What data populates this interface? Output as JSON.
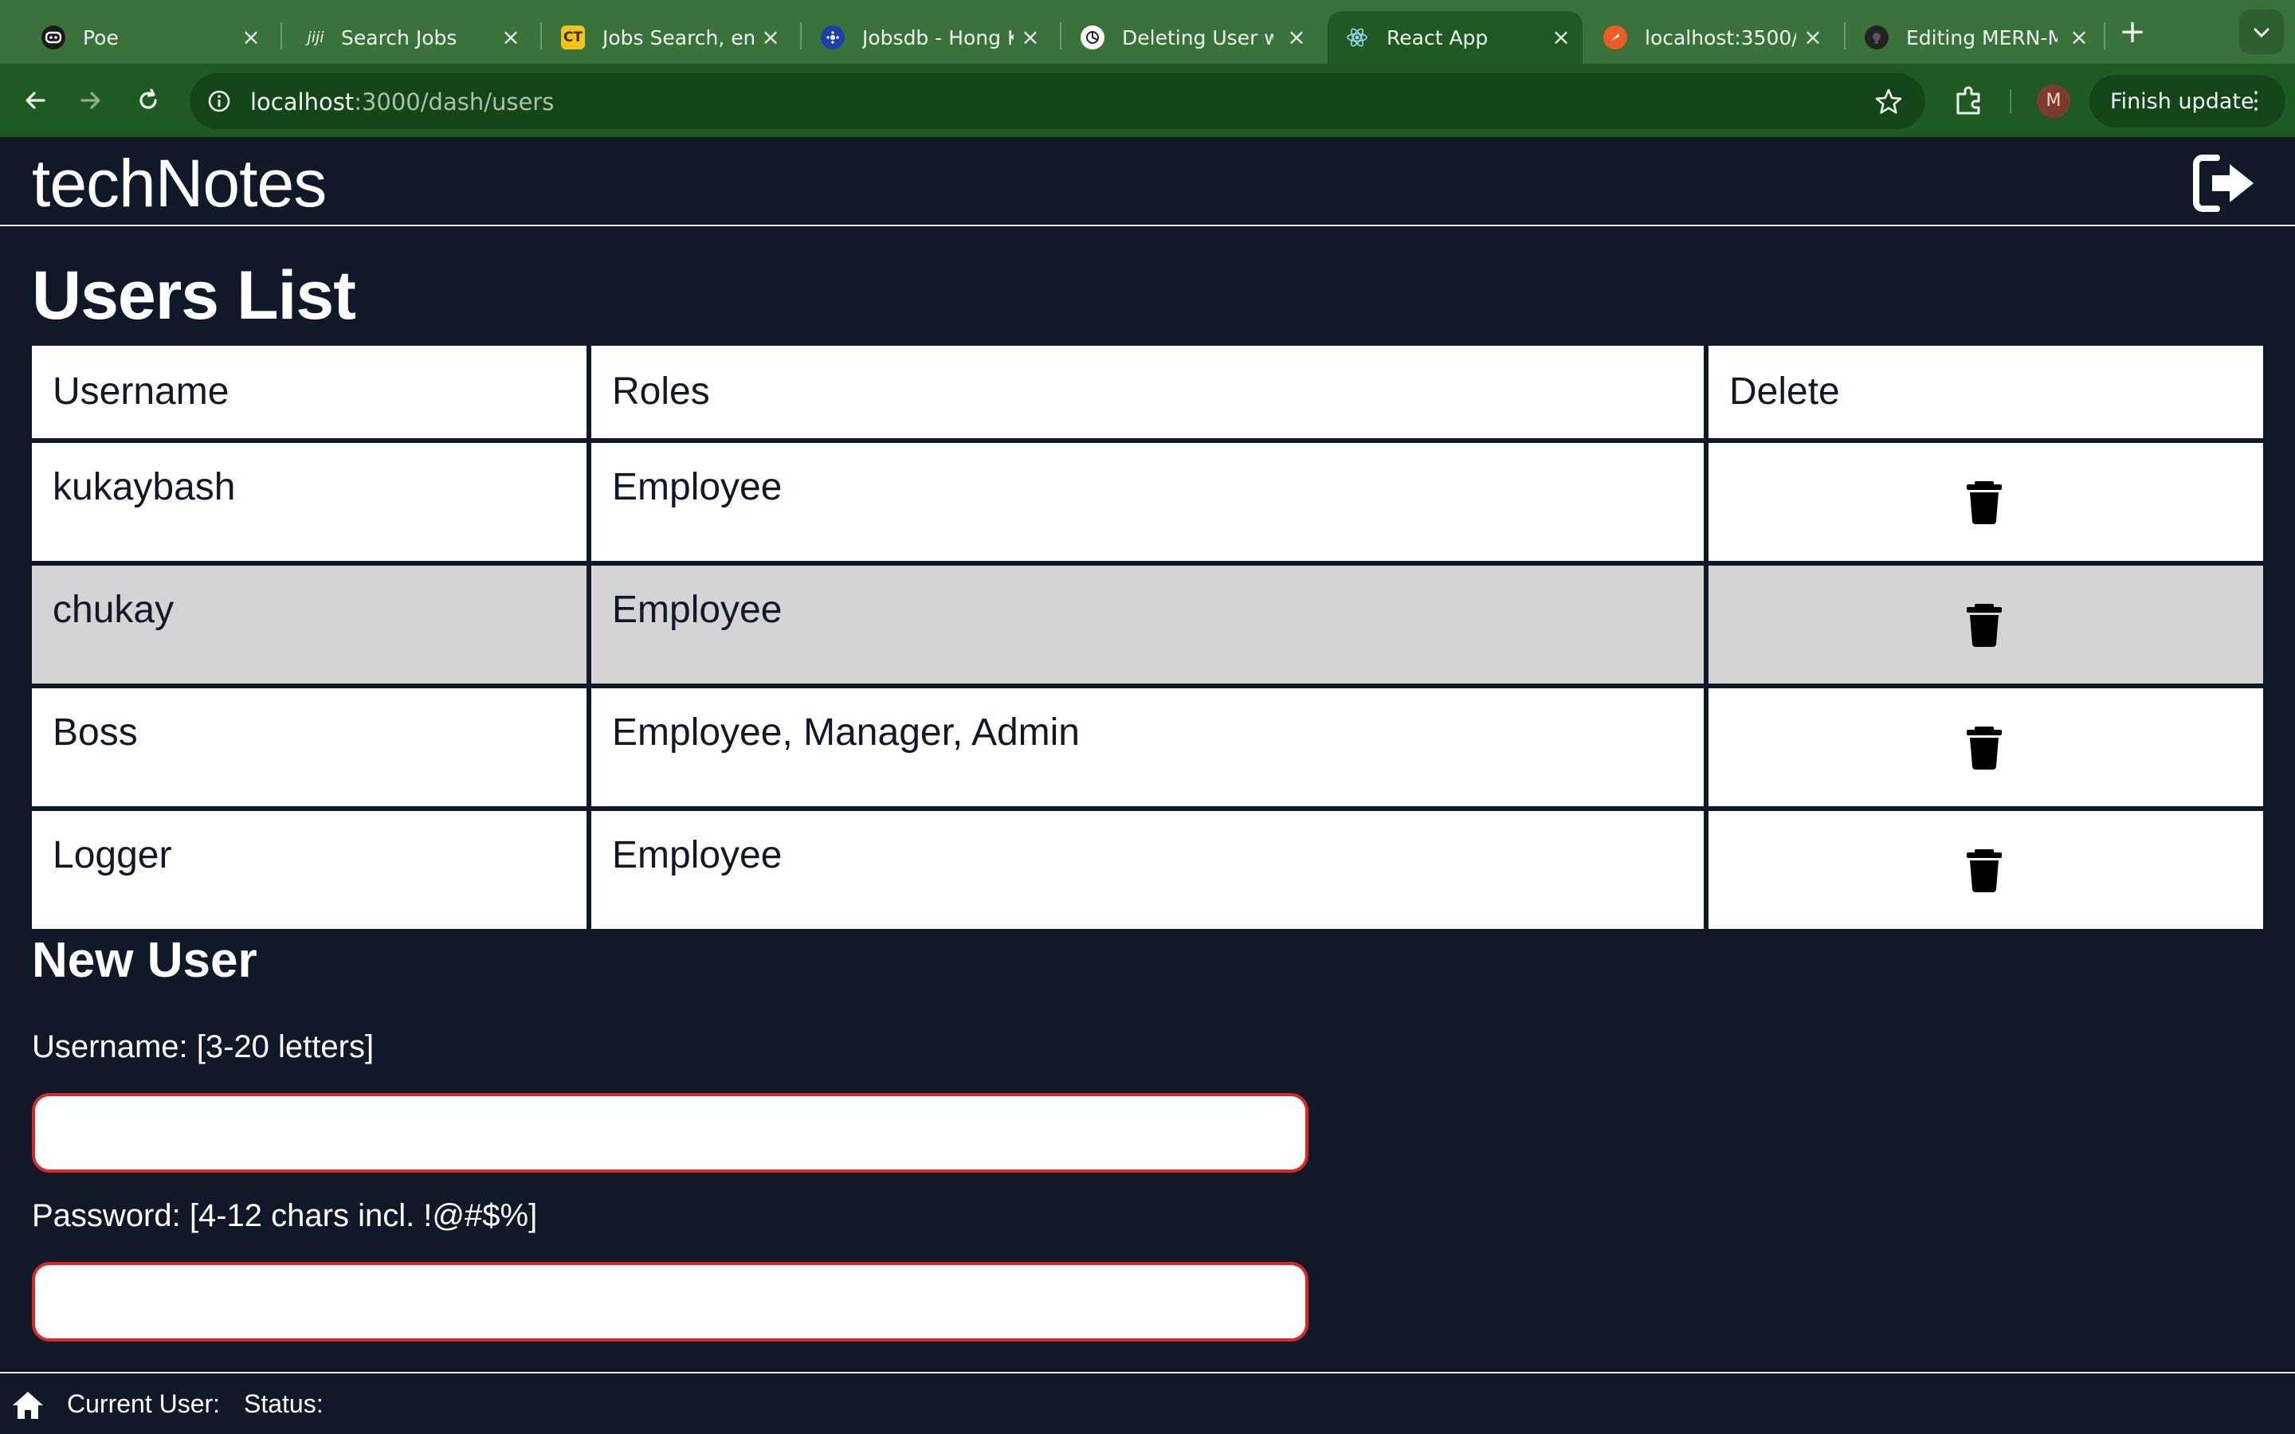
{
  "browser": {
    "tabs": [
      {
        "title": "Poe",
        "favicon": "poe-icon",
        "favicon_color": "#1a1a1a",
        "active": false
      },
      {
        "title": "Search Jobs",
        "favicon": "jiji-icon",
        "favicon_color": "#3d6e3f",
        "active": false
      },
      {
        "title": "Jobs Search, em",
        "favicon": "ct-icon",
        "favicon_color": "#f0c419",
        "active": false
      },
      {
        "title": "Jobsdb - Hong K",
        "favicon": "jobsdb-icon",
        "favicon_color": "#1d3fa8",
        "active": false
      },
      {
        "title": "Deleting User w",
        "favicon": "chatgpt-icon",
        "favicon_color": "#ffffff",
        "active": false
      },
      {
        "title": "React App",
        "favicon": "react-icon",
        "favicon_color": "#61dafb",
        "active": true
      },
      {
        "title": "localhost:3500/",
        "favicon": "postman-icon",
        "favicon_color": "#ef5b25",
        "active": false
      },
      {
        "title": "Editing MERN-M",
        "favicon": "github-icon",
        "favicon_color": "#222222",
        "active": false
      }
    ],
    "url_host": "localhost",
    "url_path": ":3000/dash/users",
    "avatar_letter": "M",
    "finish_update_label": "Finish update"
  },
  "app": {
    "title": "techNotes",
    "page_title": "Users List",
    "table": {
      "headers": [
        "Username",
        "Roles",
        "Delete"
      ],
      "rows": [
        {
          "username": "kukaybash",
          "roles": "Employee"
        },
        {
          "username": "chukay",
          "roles": "Employee"
        },
        {
          "username": "Boss",
          "roles": "Employee, Manager, Admin"
        },
        {
          "username": "Logger",
          "roles": "Employee"
        }
      ]
    },
    "form": {
      "title": "New User",
      "username_label": "Username: [3-20 letters]",
      "username_value": "",
      "password_label": "Password: [4-12 chars incl. !@#$%]",
      "password_value": ""
    },
    "footer": {
      "current_user_label": "Current User:",
      "status_label": "Status:"
    }
  },
  "colors": {
    "chrome_bg": "#39733b",
    "toolbar_bg": "#1f5a23",
    "page_bg": "#111827",
    "alt_row_bg": "#d4d4d4",
    "input_border_invalid": "#dc2626"
  }
}
